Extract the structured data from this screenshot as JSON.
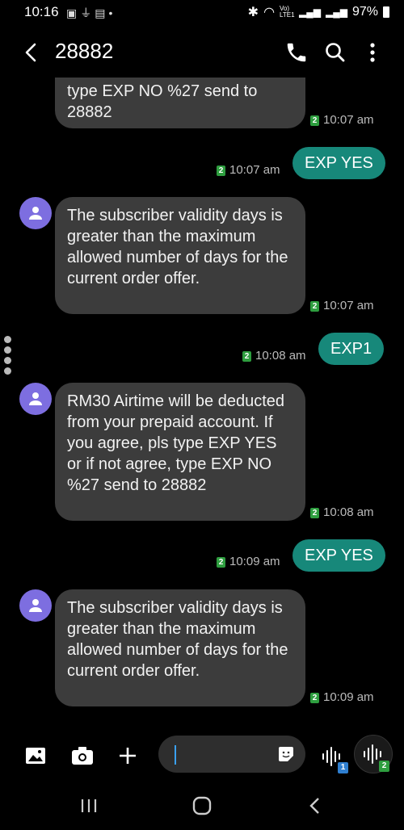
{
  "status_bar": {
    "time": "10:16",
    "network_label": "Vo) LTE1",
    "battery": "97%",
    "icons": [
      "gallery-icon",
      "usb-icon",
      "notification-icon",
      "dot-icon",
      "bluetooth-icon",
      "wifi-icon",
      "signal-icon",
      "signal2-icon",
      "battery-icon"
    ]
  },
  "header": {
    "title": "28882",
    "icons": [
      "back-arrow-icon",
      "phone-icon",
      "search-icon",
      "more-vert-icon"
    ]
  },
  "messages": [
    {
      "dir": "in",
      "text": "type EXP NO %27 send to\n28882",
      "sim": "2",
      "time": "10:07 am"
    },
    {
      "dir": "out",
      "text": "EXP YES",
      "sim": "2",
      "time": "10:07 am"
    },
    {
      "dir": "in",
      "text": "The subscriber validity days is greater than the maximum allowed number of days for the current order offer.",
      "sim": "2",
      "time": "10:07 am"
    },
    {
      "dir": "out",
      "text": "EXP1",
      "sim": "2",
      "time": "10:08 am"
    },
    {
      "dir": "in",
      "text": "RM30 Airtime will be deducted from your prepaid account. If you agree, pls type EXP YES or if not agree, type EXP NO %27 send to 28882",
      "sim": "2",
      "time": "10:08 am"
    },
    {
      "dir": "out",
      "text": "EXP YES",
      "sim": "2",
      "time": "10:09 am"
    },
    {
      "dir": "in",
      "text": "The subscriber validity days is greater than the maximum allowed number of days for the current order offer.",
      "sim": "2",
      "time": "10:09 am"
    }
  ],
  "composer": {
    "input_value": "",
    "voice_sim_1": "1",
    "voice_sim_2": "2",
    "icons": [
      "image-icon",
      "camera-icon",
      "plus-icon",
      "sticker-icon",
      "voice-wave-icon"
    ]
  },
  "nav_bar": {
    "icons": [
      "recents-icon",
      "home-icon",
      "back-icon"
    ]
  },
  "colors": {
    "background": "#000000",
    "incoming_bubble": "#3c3c3c",
    "outgoing_bubble": "#17887a",
    "avatar": "#7d6ee0",
    "sim_badge_green": "#2e9e3f",
    "sim_badge_blue": "#2f7fd0"
  }
}
